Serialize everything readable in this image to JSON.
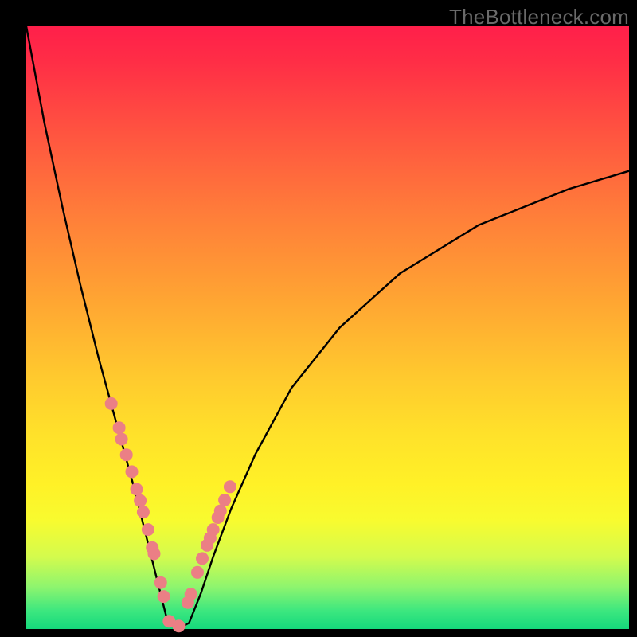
{
  "watermark_text": "TheBottleneck.com",
  "colors": {
    "frame": "#000000",
    "curve": "#000000",
    "dot": "#eb7f85",
    "gradient_stops": [
      "#ff1f4a",
      "#ff5540",
      "#ffa133",
      "#ffe22a",
      "#d4fb4d",
      "#15d97c"
    ]
  },
  "chart_data": {
    "type": "line",
    "title": "",
    "xlabel": "",
    "ylabel": "",
    "xlim": [
      0,
      100
    ],
    "ylim": [
      0,
      100
    ],
    "note": "No axis ticks or numeric labels are rendered; y is depicted as bottleneck percentage (0 at bottom, 100 at top). Values estimated from pixel positions.",
    "series": [
      {
        "name": "bottleneck-curve",
        "x": [
          0,
          3,
          6,
          9,
          12,
          15,
          18,
          20,
          22,
          23.5,
          25,
          27,
          29,
          31,
          34,
          38,
          44,
          52,
          62,
          75,
          90,
          100
        ],
        "y": [
          100,
          84,
          70,
          57,
          45,
          34,
          23,
          15,
          7,
          1,
          0,
          1,
          6,
          12,
          20,
          29,
          40,
          50,
          59,
          67,
          73,
          76
        ]
      }
    ],
    "highlight_points": {
      "name": "marked-points",
      "note": "Salmon dots clustered near the valley on both arms.",
      "x": [
        14.1,
        15.4,
        15.8,
        16.6,
        17.5,
        18.3,
        18.9,
        19.4,
        20.2,
        20.9,
        21.2,
        22.3,
        22.8,
        23.7,
        25.3,
        26.8,
        27.3,
        28.4,
        29.2,
        30.0,
        30.5,
        31.0,
        31.8,
        32.2,
        32.9,
        33.8
      ],
      "y": [
        37.4,
        33.4,
        31.5,
        28.9,
        26.1,
        23.2,
        21.3,
        19.4,
        16.5,
        13.5,
        12.5,
        7.7,
        5.4,
        1.3,
        0.5,
        4.4,
        5.8,
        9.4,
        11.7,
        13.9,
        15.1,
        16.5,
        18.5,
        19.6,
        21.4,
        23.6
      ]
    }
  }
}
